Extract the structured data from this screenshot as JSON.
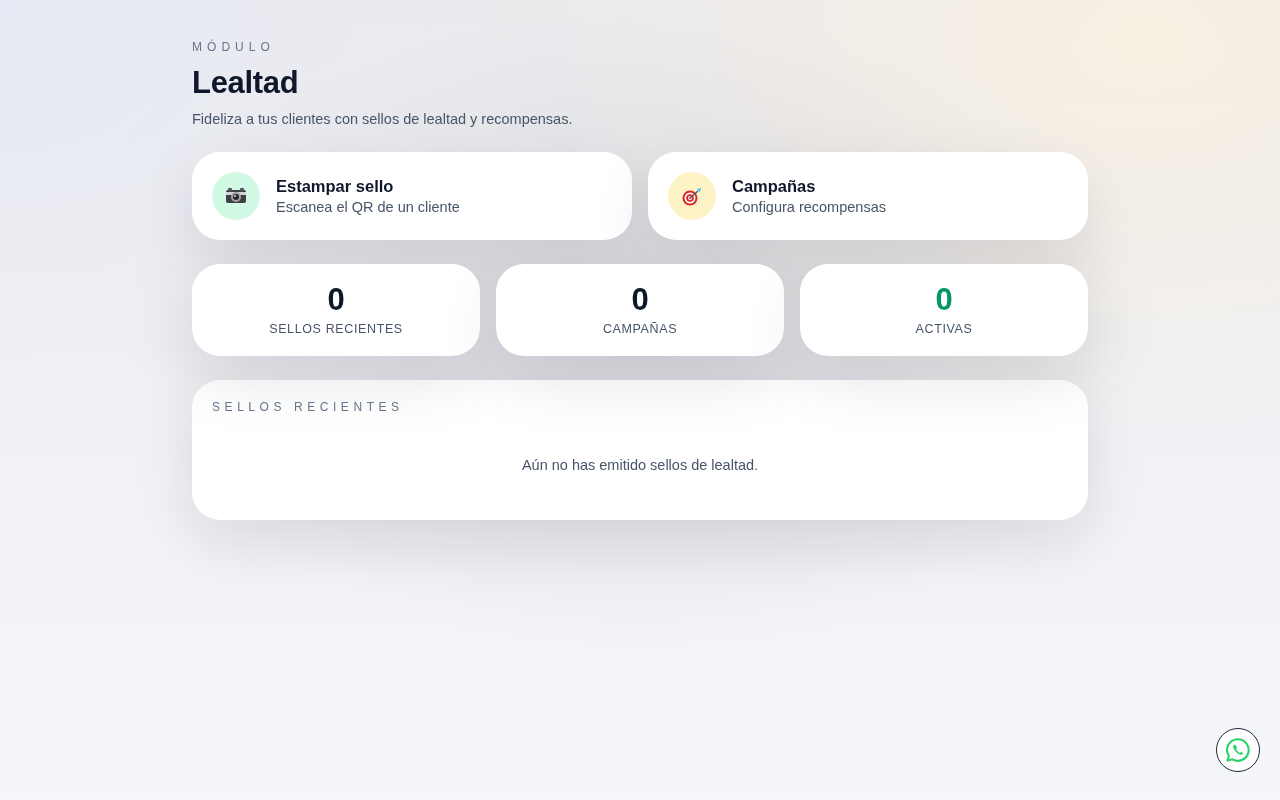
{
  "header": {
    "eyebrow": "MÓDULO",
    "title": "Lealtad",
    "subtitle": "Fideliza a tus clientes con sellos de lealtad y recompensas."
  },
  "actions": [
    {
      "title": "Estampar sello",
      "subtitle": "Escanea el QR de un cliente",
      "color": "#d1fae5"
    },
    {
      "title": "Campañas",
      "subtitle": "Configura recompensas",
      "color": "#fef3c7"
    }
  ],
  "stats": [
    {
      "value": "0",
      "label": "SELLOS RECIENTES",
      "color": "#0f172a"
    },
    {
      "value": "0",
      "label": "CAMPAÑAS",
      "color": "#0f172a"
    },
    {
      "value": "0",
      "label": "ACTIVAS",
      "color": "#059669"
    }
  ],
  "recent": {
    "heading": "SELLOS RECIENTES",
    "empty_text": "Aún no has emitido sellos de lealtad."
  }
}
